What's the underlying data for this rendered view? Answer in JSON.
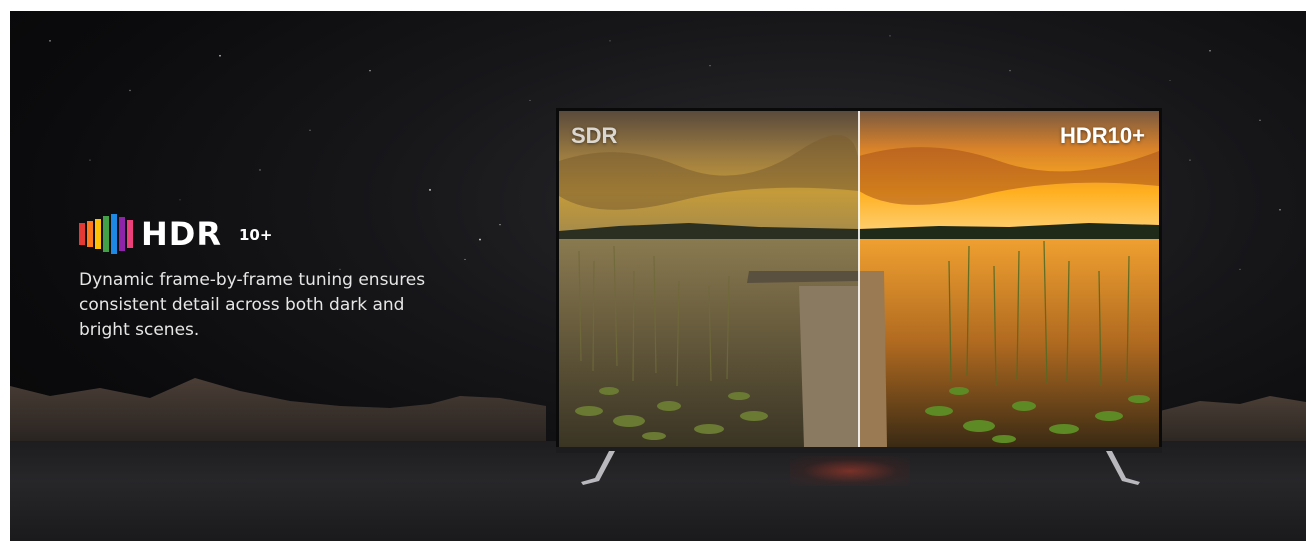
{
  "logo": {
    "wordmark": "HDR",
    "suffix": "10+",
    "bar_colors": [
      "#e53935",
      "#ff7a1a",
      "#ffc107",
      "#43a047",
      "#1e88e5",
      "#8e24aa",
      "#ec407a"
    ]
  },
  "tagline": "Dynamic frame-by-frame tuning ensures consistent detail across both dark and bright scenes.",
  "tv": {
    "left_label": "SDR",
    "right_label": "HDR10+"
  },
  "colors": {
    "background": "#0b0b0d",
    "text": "#ffffff",
    "sdr_sky": "#b88a3a",
    "hdr_sky": "#f5a21a"
  }
}
